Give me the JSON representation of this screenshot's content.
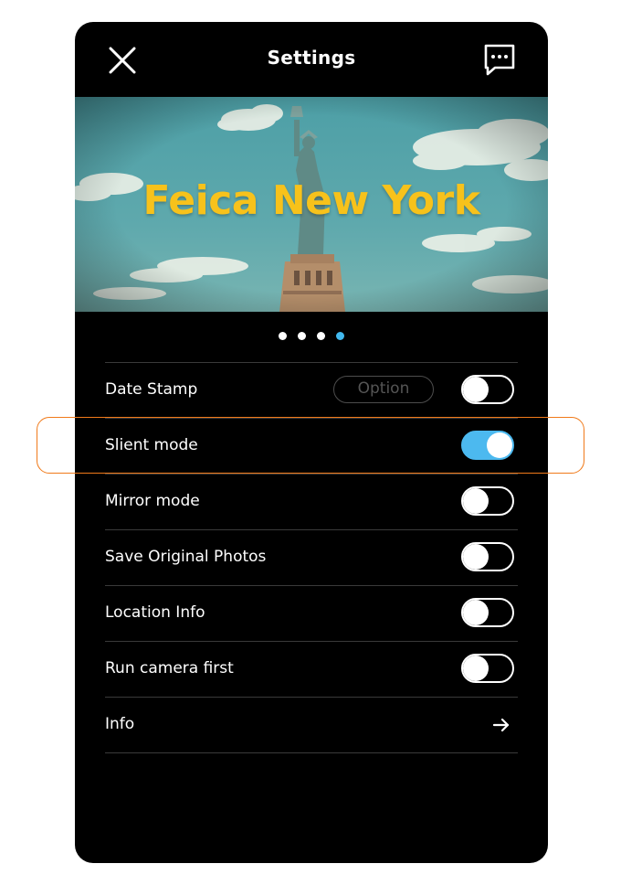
{
  "header": {
    "title": "Settings",
    "close_icon": "close-icon",
    "chat_icon": "chat-bubble-icon"
  },
  "banner": {
    "title": "Feica New York",
    "title_color": "#f7c21b"
  },
  "pager": {
    "count": 4,
    "active_index": 3,
    "active_color": "#41b8ee"
  },
  "settings": {
    "date_stamp": {
      "label": "Date Stamp",
      "option_label": "Option",
      "enabled": false
    },
    "silent_mode": {
      "label": "Slient mode",
      "enabled": true
    },
    "mirror_mode": {
      "label": "Mirror mode",
      "enabled": false
    },
    "save_original": {
      "label": "Save Original Photos",
      "enabled": false
    },
    "location_info": {
      "label": "Location Info",
      "enabled": false
    },
    "run_camera_first": {
      "label": "Run camera first",
      "enabled": false
    },
    "info": {
      "label": "Info",
      "icon": "arrow-right-icon"
    }
  },
  "colors": {
    "toggle_on": "#4cb9ef",
    "highlight": "#f07a1a",
    "background": "#000000"
  }
}
